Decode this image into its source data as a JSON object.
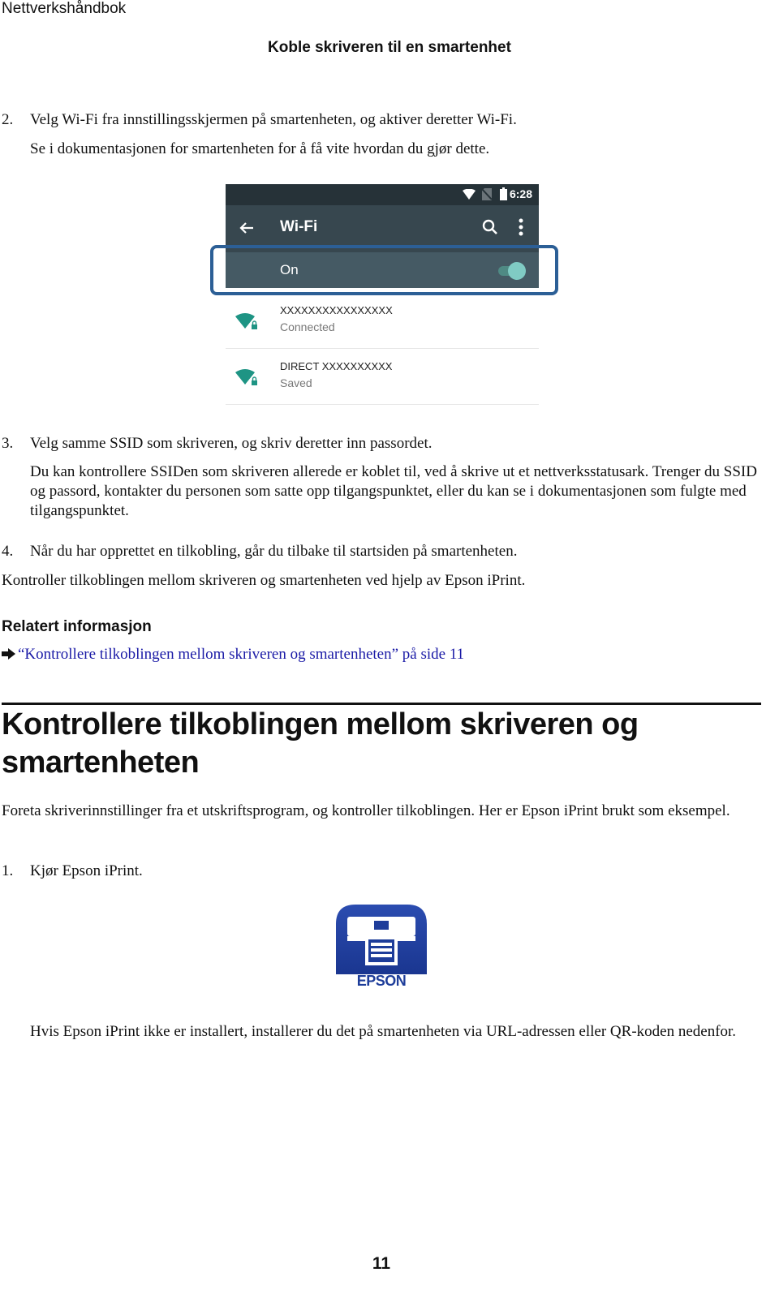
{
  "header": {
    "running_head": "Nettverkshåndbok",
    "section_title": "Koble skriveren til en smartenhet"
  },
  "steps_part1": [
    {
      "number": "2.",
      "text": "Velg Wi-Fi fra innstillingsskjermen på smartenheten, og aktiver deretter Wi-Fi.",
      "note": "Se i dokumentasjonen for smartenheten for å få vite hvordan du gjør dette."
    }
  ],
  "phone_screenshot": {
    "status_time": "6:28",
    "toolbar_title": "Wi-Fi",
    "toggle_label": "On",
    "toggle_state": "on",
    "accent_color": "#80cbc4",
    "highlight_color": "#2c5f96",
    "networks": [
      {
        "name": "XXXXXXXXXXXXXXXX",
        "status": "Connected"
      },
      {
        "name": "DIRECT  XXXXXXXXXX",
        "status": "Saved"
      }
    ]
  },
  "steps_part2": [
    {
      "number": "3.",
      "text": "Velg samme SSID som skriveren, og skriv deretter inn passordet.",
      "note": "Du kan kontrollere SSIDen som skriveren allerede er koblet til, ved å skrive ut et nettverksstatusark. Trenger du SSID og passord, kontakter du personen som satte opp tilgangspunktet, eller du kan se i dokumentasjonen som fulgte med tilgangspunktet."
    },
    {
      "number": "4.",
      "text": "Når du har opprettet en tilkobling, går du tilbake til startsiden på smartenheten."
    }
  ],
  "after_steps": "Kontroller tilkoblingen mellom skriveren og smartenheten ved hjelp av Epson iPrint.",
  "related": {
    "title": "Relatert informasjon",
    "link_text": "“Kontrollere tilkoblingen mellom skriveren og smartenheten” på side 11",
    "link_color": "#1a1aa6"
  },
  "section2": {
    "heading": "Kontrollere tilkoblingen mellom skriveren og smartenheten",
    "intro": "Foreta skriverinnstillinger fra et utskriftsprogram, og kontroller tilkoblingen. Her er Epson iPrint brukt som eksempel.",
    "step1_number": "1.",
    "step1_text": "Kjør Epson iPrint.",
    "app_icon_label": "EPSON",
    "app_icon_color": "#1e3d9a",
    "install_note": "Hvis Epson iPrint ikke er installert, installerer du det på smartenheten via URL-adressen eller QR-koden nedenfor."
  },
  "footer": {
    "page_number": "11"
  }
}
